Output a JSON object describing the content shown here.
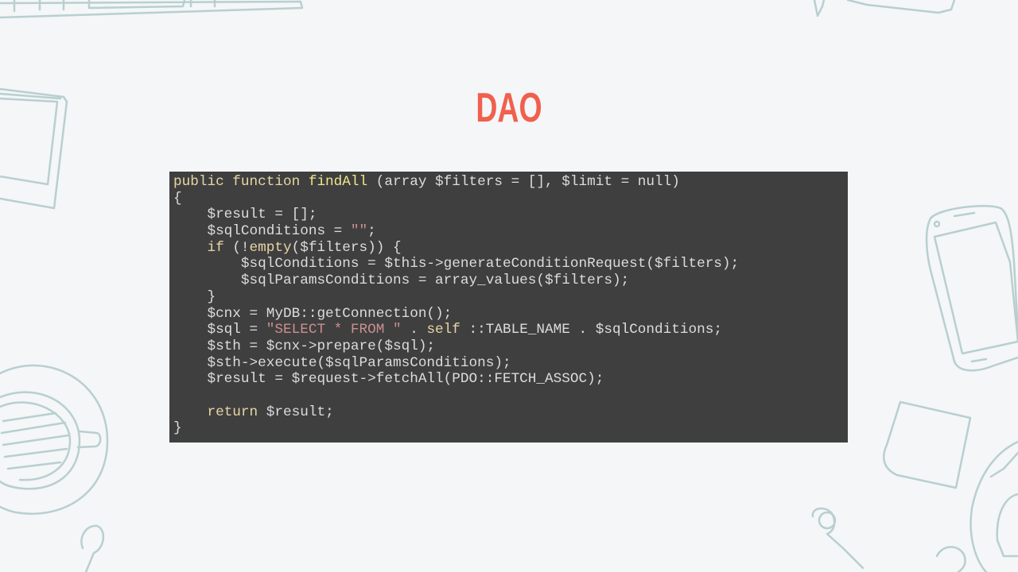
{
  "slide": {
    "title": "DAO"
  },
  "code": {
    "language": "php",
    "lines": [
      [
        {
          "t": "public function ",
          "k": "keyword"
        },
        {
          "t": "findAll",
          "k": "func"
        },
        {
          "t": " (array $filters = [], $limit = null)",
          "k": "plain"
        }
      ],
      [
        {
          "t": "{",
          "k": "plain"
        }
      ],
      [
        {
          "t": "    $result = [];",
          "k": "plain"
        }
      ],
      [
        {
          "t": "    $sqlConditions = ",
          "k": "plain"
        },
        {
          "t": "\"\"",
          "k": "string"
        },
        {
          "t": ";",
          "k": "plain"
        }
      ],
      [
        {
          "t": "    ",
          "k": "plain"
        },
        {
          "t": "if",
          "k": "keyword"
        },
        {
          "t": " (!",
          "k": "plain"
        },
        {
          "t": "empty",
          "k": "keyword"
        },
        {
          "t": "($filters)) {",
          "k": "plain"
        }
      ],
      [
        {
          "t": "        $sqlConditions = $this->generateConditionRequest($filters);",
          "k": "plain"
        }
      ],
      [
        {
          "t": "        $sqlParamsConditions = array_values($filters);",
          "k": "plain"
        }
      ],
      [
        {
          "t": "    }",
          "k": "plain"
        }
      ],
      [
        {
          "t": "    $cnx = MyDB::getConnection();",
          "k": "plain"
        }
      ],
      [
        {
          "t": "    $sql = ",
          "k": "plain"
        },
        {
          "t": "\"SELECT * FROM \"",
          "k": "string"
        },
        {
          "t": " . ",
          "k": "plain"
        },
        {
          "t": "self",
          "k": "keyword"
        },
        {
          "t": " ::TABLE_NAME . $sqlConditions;",
          "k": "plain"
        }
      ],
      [
        {
          "t": "    $sth = $cnx->prepare($sql);",
          "k": "plain"
        }
      ],
      [
        {
          "t": "    $sth->execute($sqlParamsConditions);",
          "k": "plain"
        }
      ],
      [
        {
          "t": "    $result = $request->fetchAll(PDO::FETCH_ASSOC);",
          "k": "plain"
        }
      ],
      [
        {
          "t": "",
          "k": "plain"
        }
      ],
      [
        {
          "t": "    ",
          "k": "plain"
        },
        {
          "t": "return",
          "k": "keyword"
        },
        {
          "t": " $result;",
          "k": "plain"
        }
      ],
      [
        {
          "t": "}",
          "k": "plain"
        }
      ]
    ]
  },
  "colors": {
    "background": "#f4f6f8",
    "title": "#f0604d",
    "code_background": "#3f3f3f",
    "code_text": "#dcdcdc",
    "code_keyword": "#e8d5a6",
    "code_function": "#f0e68c",
    "code_string": "#cc8f8f",
    "doodle_stroke": "#b9cfcf"
  },
  "decorations": {
    "icons": [
      "keyboard-doodle-icon",
      "notebook-doodle-icon",
      "coffee-cup-doodle-icon",
      "spoon-doodle-icon",
      "smartphone-doodle-icon",
      "sticky-note-doodle-icon",
      "headphones-doodle-icon",
      "pen-doodle-icon"
    ]
  }
}
